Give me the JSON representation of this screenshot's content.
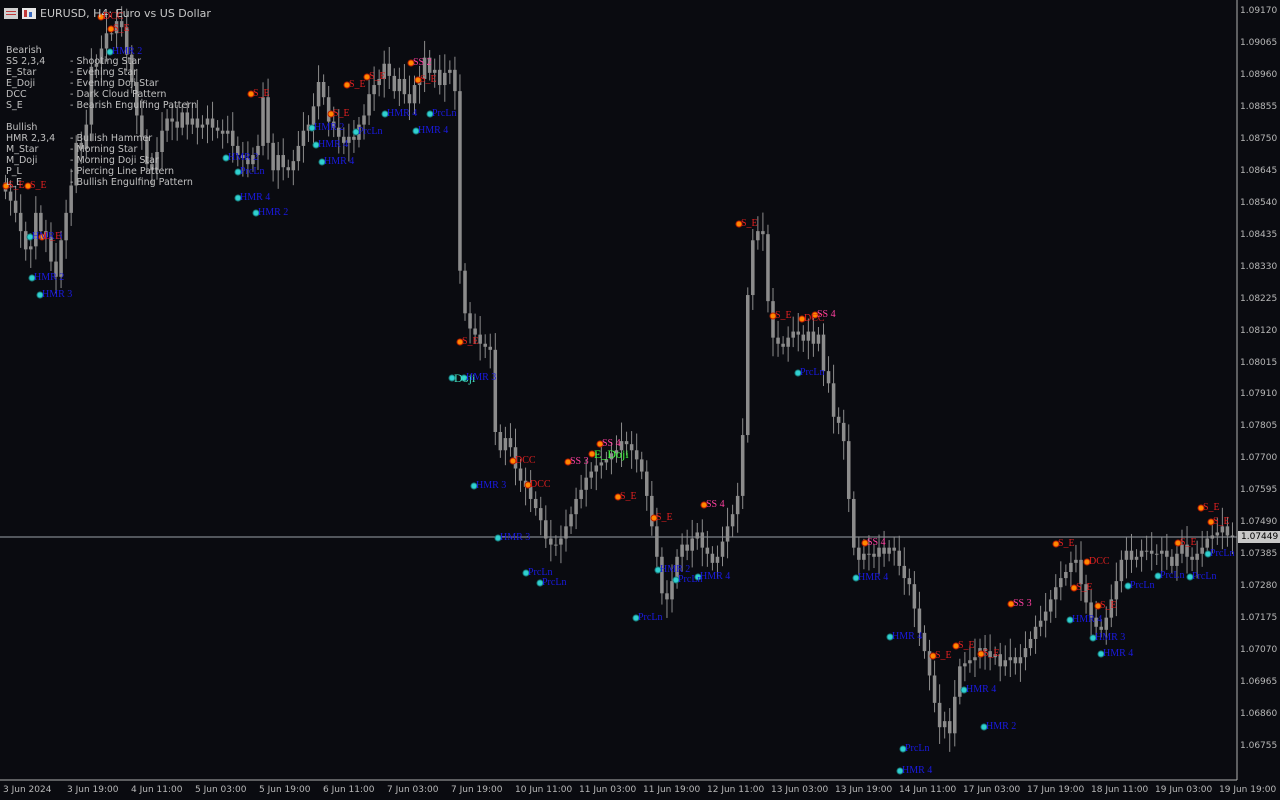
{
  "window": {
    "title": "EURUSD, H4:  Euro vs US Dollar"
  },
  "colors": {
    "background": "#0a0b10",
    "candle": "#8c8c8c",
    "axis": "#b0b0b0",
    "current_line": "#9aa0a8",
    "bearish": "#e02020",
    "bullish": "#1a1ae0",
    "marker_fill": "#ff8800",
    "marker_bull": "#30d0d0",
    "doji": "#40e0c0",
    "e_doji": "#40ff40",
    "ss": "#ff40a0"
  },
  "legend": {
    "bearish_title": "Bearish",
    "bearish": [
      {
        "code": "SS 2,3,4",
        "desc": "- Shooting Star"
      },
      {
        "code": "E_Star",
        "desc": "- Evening Star"
      },
      {
        "code": "E_Doji",
        "desc": "- Evening Doji Star"
      },
      {
        "code": "DCC",
        "desc": "- Dark Cloud Pattern"
      },
      {
        "code": "S_E",
        "desc": "- Bearish Engulfing Pattern"
      }
    ],
    "bullish_title": "Bullish",
    "bullish": [
      {
        "code": "HMR 2,3,4",
        "desc": "- Bullish Hammer"
      },
      {
        "code": "M_Star",
        "desc": "- Morning Star"
      },
      {
        "code": "M_Doji",
        "desc": "- Morning Doji Star"
      },
      {
        "code": "P_L",
        "desc": "- Piercing Line Pattern"
      },
      {
        "code": "L_E",
        "desc": "- Bullish Engulfing Pattern"
      }
    ]
  },
  "chart_data": {
    "type": "candlestick",
    "symbol": "EURUSD",
    "timeframe": "H4",
    "current_price": "1.07449",
    "y_range": [
      1.0666,
      1.092
    ],
    "price_ticks": [
      "1.09170",
      "1.09065",
      "1.08960",
      "1.08855",
      "1.08750",
      "1.08645",
      "1.08540",
      "1.08435",
      "1.08330",
      "1.08225",
      "1.08120",
      "1.08015",
      "1.07910",
      "1.07805",
      "1.07700",
      "1.07595",
      "1.07490",
      "1.07385",
      "1.07280",
      "1.07175",
      "1.07070",
      "1.06965",
      "1.06860",
      "1.06755"
    ],
    "date_ticks": [
      "3 Jun 2024",
      "3 Jun 19:00",
      "4 Jun 11:00",
      "5 Jun 03:00",
      "5 Jun 19:00",
      "6 Jun 11:00",
      "7 Jun 03:00",
      "7 Jun 19:00",
      "10 Jun 11:00",
      "11 Jun 03:00",
      "11 Jun 19:00",
      "12 Jun 11:00",
      "13 Jun 03:00",
      "13 Jun 19:00",
      "14 Jun 11:00",
      "17 Jun 03:00",
      "17 Jun 19:00",
      "18 Jun 11:00",
      "19 Jun 03:00",
      "19 Jun 19:00"
    ],
    "closes": [
      1.0858,
      1.0855,
      1.0851,
      1.0845,
      1.0839,
      1.084,
      1.0851,
      1.0845,
      1.0843,
      1.0835,
      1.083,
      1.0842,
      1.0851,
      1.086,
      1.0874,
      1.0872,
      1.088,
      1.0899,
      1.09,
      1.0905,
      1.091,
      1.091,
      1.0914,
      1.0912,
      1.0903,
      1.0894,
      1.0883,
      1.0876,
      1.0867,
      1.0865,
      1.0871,
      1.0878,
      1.0882,
      1.0881,
      1.0879,
      1.0884,
      1.088,
      1.0882,
      1.0879,
      1.088,
      1.0882,
      1.0879,
      1.0878,
      1.0877,
      1.0878,
      1.0873,
      1.087,
      1.0869,
      1.0867,
      1.087,
      1.0873,
      1.0889,
      1.0874,
      1.0865,
      1.087,
      1.0866,
      1.0865,
      1.0868,
      1.0873,
      1.0878,
      1.088,
      1.0886,
      1.0894,
      1.0889,
      1.0881,
      1.0879,
      1.0876,
      1.0874,
      1.0876,
      1.0875,
      1.088,
      1.0883,
      1.089,
      1.0893,
      1.0895,
      1.09,
      1.0896,
      1.0891,
      1.0895,
      1.089,
      1.0887,
      1.0893,
      1.0895,
      1.0902,
      1.0897,
      1.0898,
      1.0893,
      1.0897,
      1.0898,
      1.0891,
      1.0832,
      1.0818,
      1.0813,
      1.0811,
      1.0808,
      1.0807,
      1.0806,
      1.0779,
      1.0773,
      1.0777,
      1.0774,
      1.0767,
      1.0763,
      1.0761,
      1.0757,
      1.0754,
      1.075,
      1.0744,
      1.0742,
      1.0742,
      1.0744,
      1.0748,
      1.0752,
      1.0757,
      1.076,
      1.0764,
      1.0766,
      1.0768,
      1.0769,
      1.077,
      1.0772,
      1.0773,
      1.0776,
      1.0775,
      1.0773,
      1.077,
      1.0766,
      1.0758,
      1.0748,
      1.0738,
      1.0726,
      1.0724,
      1.073,
      1.0738,
      1.0742,
      1.074,
      1.0744,
      1.0746,
      1.0741,
      1.0739,
      1.0736,
      1.0738,
      1.0743,
      1.0748,
      1.0752,
      1.0758,
      1.0778,
      1.0824,
      1.0842,
      1.0845,
      1.0844,
      1.0822,
      1.081,
      1.0808,
      1.0807,
      1.081,
      1.0812,
      1.0811,
      1.0809,
      1.0812,
      1.0808,
      1.0811,
      1.0799,
      1.0795,
      1.0784,
      1.0782,
      1.0776,
      1.0757,
      1.0741,
      1.0737,
      1.0739,
      1.0739,
      1.0738,
      1.0741,
      1.0739,
      1.0741,
      1.074,
      1.0735,
      1.0731,
      1.0729,
      1.0721,
      1.0713,
      1.0707,
      1.0699,
      1.069,
      1.0682,
      1.0684,
      1.068,
      1.0692,
      1.0702,
      1.0703,
      1.0704,
      1.0705,
      1.0708,
      1.0707,
      1.0705,
      1.0706,
      1.0702,
      1.0704,
      1.0705,
      1.0703,
      1.0705,
      1.0708,
      1.0711,
      1.0715,
      1.0717,
      1.072,
      1.0724,
      1.0728,
      1.0731,
      1.0733,
      1.0736,
      1.0737,
      1.0729,
      1.0723,
      1.0718,
      1.0715,
      1.0714,
      1.0718,
      1.0724,
      1.073,
      1.0737,
      1.074,
      1.0737,
      1.0738,
      1.074,
      1.074,
      1.0739,
      1.0739,
      1.074,
      1.0738,
      1.0735,
      1.0739,
      1.0742,
      1.0738,
      1.0737,
      1.0739,
      1.0741,
      1.0744,
      1.0745,
      1.0746,
      1.0748,
      1.0745,
      1.0745
    ]
  },
  "annotations": [
    {
      "text": "DCC",
      "x": 103,
      "y": 17,
      "kind": "bear"
    },
    {
      "text": "S_E",
      "x": 113,
      "y": 29,
      "kind": "bear"
    },
    {
      "text": "HMR 2",
      "x": 112,
      "y": 52,
      "kind": "bull"
    },
    {
      "text": "S_E",
      "x": 253,
      "y": 94,
      "kind": "bear"
    },
    {
      "text": "S_E",
      "x": 8,
      "y": 186,
      "kind": "bear"
    },
    {
      "text": "S_E",
      "x": 30,
      "y": 186,
      "kind": "bear"
    },
    {
      "text": "HMR 3",
      "x": 32,
      "y": 237,
      "kind": "bull"
    },
    {
      "text": "L_E",
      "x": 44,
      "y": 237,
      "kind": "bear"
    },
    {
      "text": "HMR 2",
      "x": 34,
      "y": 278,
      "kind": "bull"
    },
    {
      "text": "HMR 3",
      "x": 42,
      "y": 295,
      "kind": "bull"
    },
    {
      "text": "HMR 2",
      "x": 228,
      "y": 158,
      "kind": "bull"
    },
    {
      "text": "PrcLn",
      "x": 240,
      "y": 172,
      "kind": "bull"
    },
    {
      "text": "HMR 4",
      "x": 240,
      "y": 198,
      "kind": "bull"
    },
    {
      "text": "HMR 2",
      "x": 258,
      "y": 213,
      "kind": "bull"
    },
    {
      "text": "S_E",
      "x": 349,
      "y": 85,
      "kind": "bear"
    },
    {
      "text": "S_E",
      "x": 369,
      "y": 77,
      "kind": "bear"
    },
    {
      "text": "S_E",
      "x": 333,
      "y": 114,
      "kind": "bear"
    },
    {
      "text": "HMR 2",
      "x": 314,
      "y": 128,
      "kind": "bull"
    },
    {
      "text": "HMR 4",
      "x": 318,
      "y": 145,
      "kind": "bull"
    },
    {
      "text": "HMR 4",
      "x": 324,
      "y": 162,
      "kind": "bull"
    },
    {
      "text": "PrcLn",
      "x": 358,
      "y": 132,
      "kind": "bull"
    },
    {
      "text": "SS 2",
      "x": 413,
      "y": 63,
      "kind": "ss"
    },
    {
      "text": "S_E",
      "x": 420,
      "y": 80,
      "kind": "bear"
    },
    {
      "text": "HMR 4",
      "x": 387,
      "y": 114,
      "kind": "bull"
    },
    {
      "text": "PrcLn",
      "x": 432,
      "y": 114,
      "kind": "bull"
    },
    {
      "text": "HMR 4",
      "x": 418,
      "y": 131,
      "kind": "bull"
    },
    {
      "text": "S_E",
      "x": 462,
      "y": 342,
      "kind": "bear"
    },
    {
      "text": "Doji",
      "x": 454,
      "y": 378,
      "kind": "doji"
    },
    {
      "text": "HMR 3",
      "x": 466,
      "y": 378,
      "kind": "bull"
    },
    {
      "text": "DCC",
      "x": 515,
      "y": 461,
      "kind": "bear"
    },
    {
      "text": "DCC",
      "x": 530,
      "y": 485,
      "kind": "bear"
    },
    {
      "text": "SS 3",
      "x": 570,
      "y": 462,
      "kind": "ss"
    },
    {
      "text": "SS 4",
      "x": 602,
      "y": 444,
      "kind": "ss"
    },
    {
      "text": "E_Doji",
      "x": 594,
      "y": 454,
      "kind": "edoji"
    },
    {
      "text": "HMR 3",
      "x": 476,
      "y": 486,
      "kind": "bull"
    },
    {
      "text": "HMR 3",
      "x": 500,
      "y": 538,
      "kind": "bull"
    },
    {
      "text": "PrcLn",
      "x": 528,
      "y": 573,
      "kind": "bull"
    },
    {
      "text": "PrcLn",
      "x": 542,
      "y": 583,
      "kind": "bull"
    },
    {
      "text": "S_E",
      "x": 620,
      "y": 497,
      "kind": "bear"
    },
    {
      "text": "S_E",
      "x": 656,
      "y": 518,
      "kind": "bear"
    },
    {
      "text": "PrcLn",
      "x": 638,
      "y": 618,
      "kind": "bull"
    },
    {
      "text": "HMR 2",
      "x": 660,
      "y": 570,
      "kind": "bull"
    },
    {
      "text": "PrcLn",
      "x": 678,
      "y": 580,
      "kind": "bull"
    },
    {
      "text": "SS 4",
      "x": 706,
      "y": 505,
      "kind": "ss"
    },
    {
      "text": "HMR 4",
      "x": 700,
      "y": 577,
      "kind": "bull"
    },
    {
      "text": "S_E",
      "x": 741,
      "y": 224,
      "kind": "bear"
    },
    {
      "text": "S_E",
      "x": 775,
      "y": 316,
      "kind": "bear"
    },
    {
      "text": "DCC",
      "x": 804,
      "y": 319,
      "kind": "bear"
    },
    {
      "text": "SS 4",
      "x": 817,
      "y": 315,
      "kind": "ss"
    },
    {
      "text": "PrcLn",
      "x": 800,
      "y": 373,
      "kind": "bull"
    },
    {
      "text": "SS 4",
      "x": 867,
      "y": 543,
      "kind": "ss"
    },
    {
      "text": "HMR 4",
      "x": 858,
      "y": 578,
      "kind": "bull"
    },
    {
      "text": "HMR 4",
      "x": 892,
      "y": 637,
      "kind": "bull"
    },
    {
      "text": "PrcLn",
      "x": 905,
      "y": 749,
      "kind": "bull"
    },
    {
      "text": "HMR 4",
      "x": 902,
      "y": 771,
      "kind": "bull"
    },
    {
      "text": "S_E",
      "x": 935,
      "y": 656,
      "kind": "bear"
    },
    {
      "text": "S_E",
      "x": 958,
      "y": 646,
      "kind": "bear"
    },
    {
      "text": "S_E",
      "x": 983,
      "y": 654,
      "kind": "bear"
    },
    {
      "text": "HMR 4",
      "x": 966,
      "y": 690,
      "kind": "bull"
    },
    {
      "text": "HMR 2",
      "x": 986,
      "y": 727,
      "kind": "bull"
    },
    {
      "text": "SS 3",
      "x": 1013,
      "y": 604,
      "kind": "ss"
    },
    {
      "text": "S_E",
      "x": 1058,
      "y": 544,
      "kind": "bear"
    },
    {
      "text": "S_E",
      "x": 1076,
      "y": 588,
      "kind": "bear"
    },
    {
      "text": "DCC",
      "x": 1089,
      "y": 562,
      "kind": "bear"
    },
    {
      "text": "S_E",
      "x": 1100,
      "y": 606,
      "kind": "bear"
    },
    {
      "text": "HMR 4",
      "x": 1072,
      "y": 620,
      "kind": "bull"
    },
    {
      "text": "HMR 3",
      "x": 1095,
      "y": 638,
      "kind": "bull"
    },
    {
      "text": "HMR 4",
      "x": 1103,
      "y": 654,
      "kind": "bull"
    },
    {
      "text": "PrcLn",
      "x": 1130,
      "y": 586,
      "kind": "bull"
    },
    {
      "text": "S_E",
      "x": 1180,
      "y": 543,
      "kind": "bear"
    },
    {
      "text": "PrcLn",
      "x": 1160,
      "y": 576,
      "kind": "bull"
    },
    {
      "text": "PrcLn",
      "x": 1192,
      "y": 577,
      "kind": "bull"
    },
    {
      "text": "S_E",
      "x": 1203,
      "y": 508,
      "kind": "bear"
    },
    {
      "text": "S_E",
      "x": 1213,
      "y": 522,
      "kind": "bear"
    },
    {
      "text": "PrcLn",
      "x": 1210,
      "y": 554,
      "kind": "bull"
    }
  ]
}
